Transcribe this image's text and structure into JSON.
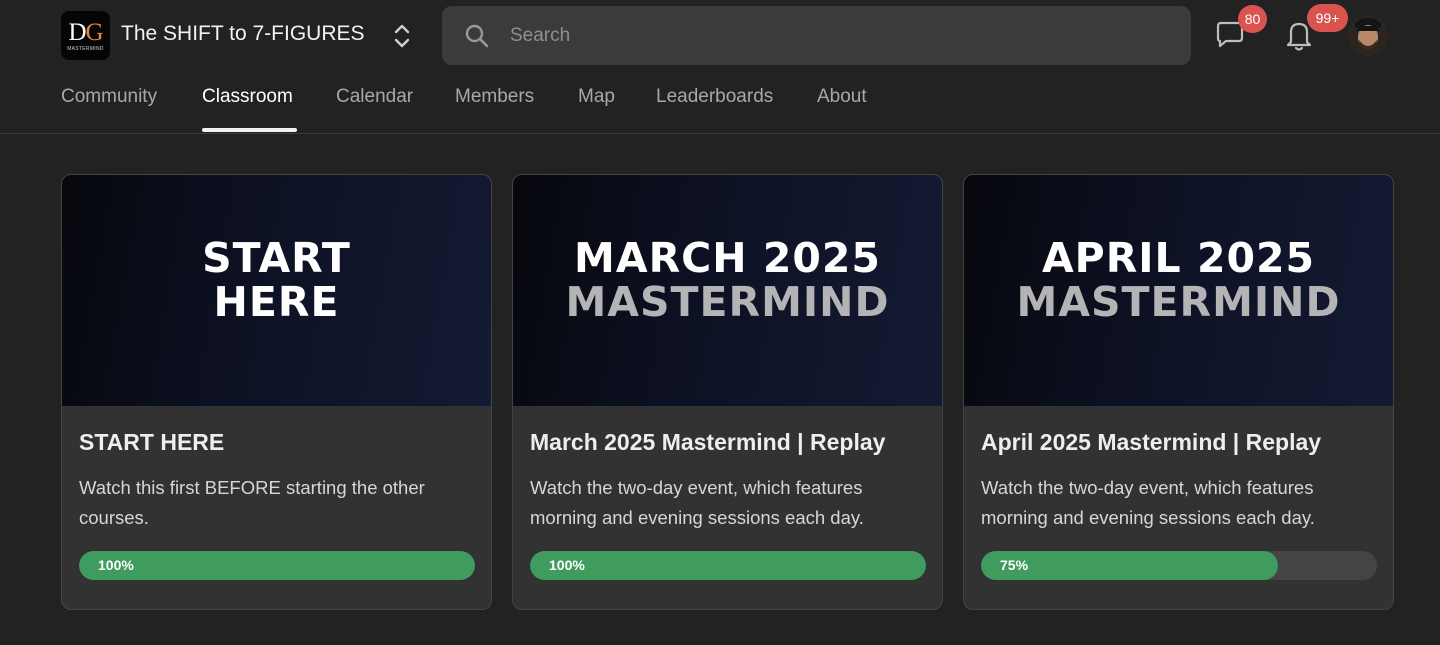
{
  "header": {
    "logo_text_d": "D",
    "logo_text_g": "G",
    "logo_subtitle": "MASTERMIND",
    "community_name": "The SHIFT to 7-FIGURES",
    "switcher_icon": "chevron-up-down-icon",
    "search_placeholder": "Search",
    "search_value": "",
    "chat_badge": "80",
    "notifications_badge": "99+"
  },
  "tabs": [
    {
      "label": "Community",
      "active": false
    },
    {
      "label": "Classroom",
      "active": true
    },
    {
      "label": "Calendar",
      "active": false
    },
    {
      "label": "Members",
      "active": false
    },
    {
      "label": "Map",
      "active": false
    },
    {
      "label": "Leaderboards",
      "active": false
    },
    {
      "label": "About",
      "active": false
    }
  ],
  "courses": [
    {
      "cover_line1": "START",
      "cover_line2": "HERE",
      "title": "START HERE",
      "description": "Watch this first BEFORE starting the other courses.",
      "progress": 100,
      "progress_label": "100%"
    },
    {
      "cover_line1": "MARCH 2025",
      "cover_line2": "MASTERMIND",
      "title": "March 2025 Mastermind | Replay",
      "description": "Watch the two-day event, which features morning and evening sessions each day.",
      "progress": 100,
      "progress_label": "100%"
    },
    {
      "cover_line1": "APRIL 2025",
      "cover_line2": "MASTERMIND",
      "title": "April 2025 Mastermind | Replay",
      "description": "Watch the two-day event, which features morning and evening sessions each day.",
      "progress": 75,
      "progress_label": "75%"
    }
  ],
  "colors": {
    "background": "#222222",
    "card": "#323232",
    "progress_fill": "#3f9b5e",
    "progress_track": "#444444",
    "badge": "#d9534f"
  }
}
